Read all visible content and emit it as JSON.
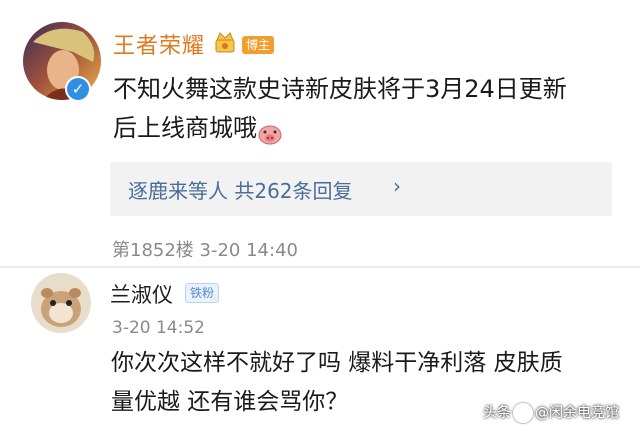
{
  "post": {
    "author": "王者荣耀",
    "badge": "博主",
    "text_line1": "不知火舞这款史诗新皮肤将于3月24日更新",
    "text_line2": "后上线商城哦",
    "reply_summary": "逐鹿来等人 共262条回复",
    "reply_chevron": "›",
    "floor_info": "第1852楼 3-20 14:40",
    "verified_icon": "verified-check-icon"
  },
  "reply": {
    "author": "兰淑仪",
    "badge": "铁粉",
    "time": "3-20 14:52",
    "text_line1": "你次次这样不就好了吗 爆料干净利落 皮肤质",
    "text_line2": "量优越 还有谁会骂你？"
  },
  "watermark": {
    "prefix": "头条",
    "handle": "@闲余电竞馆"
  },
  "colors": {
    "author_orange": "#e07a1e",
    "link_blue": "#4a6e9a",
    "badge_orange": "#f29e2e",
    "verified_blue": "#2f8fe4"
  }
}
